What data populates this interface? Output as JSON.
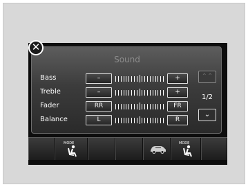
{
  "header": {
    "title": "Sound",
    "close_icon": "close-icon"
  },
  "settings": [
    {
      "label": "Bass",
      "left": "–",
      "right": "+"
    },
    {
      "label": "Treble",
      "left": "–",
      "right": "+"
    },
    {
      "label": "Fader",
      "left": "RR",
      "right": "FR"
    },
    {
      "label": "Balance",
      "left": "L",
      "right": "R"
    }
  ],
  "pager": {
    "indicator": "1/2",
    "up_icon": "chevron-up-icon",
    "down_icon": "chevron-down-icon"
  },
  "bottom_bar": {
    "left_mode_label": "MODE",
    "right_mode_label": "MODE",
    "left_icon": "seat-mode-icon",
    "center_icon": "car-audio-icon",
    "right_icon": "seat-mode-icon"
  }
}
